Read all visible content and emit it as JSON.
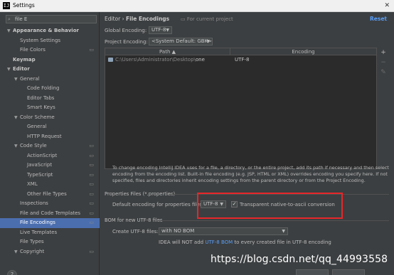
{
  "window": {
    "title": "Settings",
    "app_icon": "IJ"
  },
  "search": {
    "value": "file E"
  },
  "tree": [
    {
      "label": "Appearance & Behavior",
      "arrow": "▼",
      "indent": 1,
      "bold": true,
      "project_icon": false,
      "selected": false
    },
    {
      "label": "System Settings",
      "arrow": "",
      "indent": 2,
      "bold": false,
      "project_icon": false,
      "selected": false
    },
    {
      "label": "File Colors",
      "arrow": "",
      "indent": 2,
      "bold": false,
      "project_icon": true,
      "selected": false
    },
    {
      "label": "Keymap",
      "arrow": "",
      "indent": 1,
      "bold": true,
      "project_icon": false,
      "selected": false
    },
    {
      "label": "Editor",
      "arrow": "▼",
      "indent": 1,
      "bold": true,
      "project_icon": false,
      "selected": false
    },
    {
      "label": "General",
      "arrow": "▼",
      "indent": 2,
      "bold": false,
      "project_icon": false,
      "selected": false
    },
    {
      "label": "Code Folding",
      "arrow": "",
      "indent": 3,
      "bold": false,
      "project_icon": false,
      "selected": false
    },
    {
      "label": "Editor Tabs",
      "arrow": "",
      "indent": 3,
      "bold": false,
      "project_icon": false,
      "selected": false
    },
    {
      "label": "Smart Keys",
      "arrow": "",
      "indent": 3,
      "bold": false,
      "project_icon": false,
      "selected": false
    },
    {
      "label": "Color Scheme",
      "arrow": "▼",
      "indent": 2,
      "bold": false,
      "project_icon": false,
      "selected": false
    },
    {
      "label": "General",
      "arrow": "",
      "indent": 3,
      "bold": false,
      "project_icon": false,
      "selected": false
    },
    {
      "label": "HTTP Request",
      "arrow": "",
      "indent": 3,
      "bold": false,
      "project_icon": false,
      "selected": false
    },
    {
      "label": "Code Style",
      "arrow": "▼",
      "indent": 2,
      "bold": false,
      "project_icon": true,
      "selected": false
    },
    {
      "label": "ActionScript",
      "arrow": "",
      "indent": 3,
      "bold": false,
      "project_icon": true,
      "selected": false
    },
    {
      "label": "JavaScript",
      "arrow": "",
      "indent": 3,
      "bold": false,
      "project_icon": true,
      "selected": false
    },
    {
      "label": "TypeScript",
      "arrow": "",
      "indent": 3,
      "bold": false,
      "project_icon": true,
      "selected": false
    },
    {
      "label": "XML",
      "arrow": "",
      "indent": 3,
      "bold": false,
      "project_icon": true,
      "selected": false
    },
    {
      "label": "Other File Types",
      "arrow": "",
      "indent": 3,
      "bold": false,
      "project_icon": true,
      "selected": false
    },
    {
      "label": "Inspections",
      "arrow": "",
      "indent": 2,
      "bold": false,
      "project_icon": true,
      "selected": false
    },
    {
      "label": "File and Code Templates",
      "arrow": "",
      "indent": 2,
      "bold": false,
      "project_icon": true,
      "selected": false
    },
    {
      "label": "File Encodings",
      "arrow": "",
      "indent": 2,
      "bold": false,
      "project_icon": true,
      "selected": true
    },
    {
      "label": "Live Templates",
      "arrow": "",
      "indent": 2,
      "bold": false,
      "project_icon": false,
      "selected": false
    },
    {
      "label": "File Types",
      "arrow": "",
      "indent": 2,
      "bold": false,
      "project_icon": false,
      "selected": false
    },
    {
      "label": "Copyright",
      "arrow": "▼",
      "indent": 2,
      "bold": false,
      "project_icon": true,
      "selected": false
    }
  ],
  "breadcrumb": {
    "parent": "Editor",
    "separator": "›",
    "current": "File Encodings"
  },
  "project_note": "For current project",
  "reset_label": "Reset",
  "global_encoding": {
    "label": "Global Encoding:",
    "value": "UTF-8"
  },
  "project_encoding": {
    "label": "Project Encoding:",
    "value": "<System Default: GBK>"
  },
  "table": {
    "columns": [
      "Path ▲",
      "Encoding"
    ],
    "rows": [
      {
        "path_prefix": "C:\\Users\\Administrator\\Desktop\\",
        "path_name": "one",
        "encoding": "UTF-8"
      }
    ]
  },
  "tools": {
    "add": "+",
    "remove": "−",
    "edit": "✎"
  },
  "info_text": "To change encoding IntelliJ IDEA uses for a file, a directory, or the entire project, add its path if necessary and then select encoding from the encoding list. Built-in file encoding (e.g. JSP, HTML or XML) overrides encoding you specify here. If not specified, files and directories inherit encoding settings from the parent directory or from the Project Encoding.",
  "properties": {
    "section": "Properties Files (*.properties)",
    "label": "Default encoding for properties files:",
    "value": "UTF-8",
    "native_checkbox": {
      "checked": true,
      "label": "Transparent native-to-ascii conversion"
    }
  },
  "bom": {
    "section": "BOM for new UTF-8 files",
    "label": "Create UTF-8 files:",
    "value": "with NO BOM",
    "note_prefix": "IDEA will NOT add ",
    "note_link": "UTF-8 BOM",
    "note_suffix": " to every created file in UTF-8 encoding"
  },
  "help_label": "?",
  "watermark": "https://blog.csdn.net/qq_44993558",
  "colors": {
    "selection": "#4b6eaf",
    "link": "#589df6",
    "highlight": "#e8262a",
    "background": "#3c3f41"
  }
}
